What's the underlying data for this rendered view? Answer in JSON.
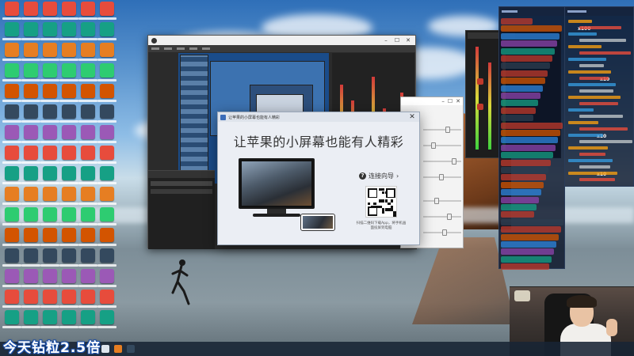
{
  "dialog": {
    "title": "让苹果的小屏幕也能有人精彩",
    "headline": "让苹果的小屏幕也能有人精彩",
    "guide_link": "连接向导",
    "guide_arrow": "›",
    "help_glyph": "?",
    "close_glyph": "✕",
    "qr_caption": "扫描二维码下载App，将手机画面投屏到电脑"
  },
  "obs": {
    "close_glyph": "✕",
    "maximize_glyph": "☐",
    "minimize_glyph": "–"
  },
  "settings_window": {
    "close_glyph": "✕",
    "maximize_glyph": "☐",
    "minimize_glyph": "–"
  },
  "overlay": {
    "promo_text": "今天钻粒2.5倍",
    "gift_counts": [
      "x100",
      "x10",
      "x10",
      "x10"
    ]
  },
  "colors": {
    "accent": "#1b4fa8",
    "chat_bg": "#0a1428",
    "meter_green": "#3ed33e",
    "meter_red": "#d33a3a"
  }
}
